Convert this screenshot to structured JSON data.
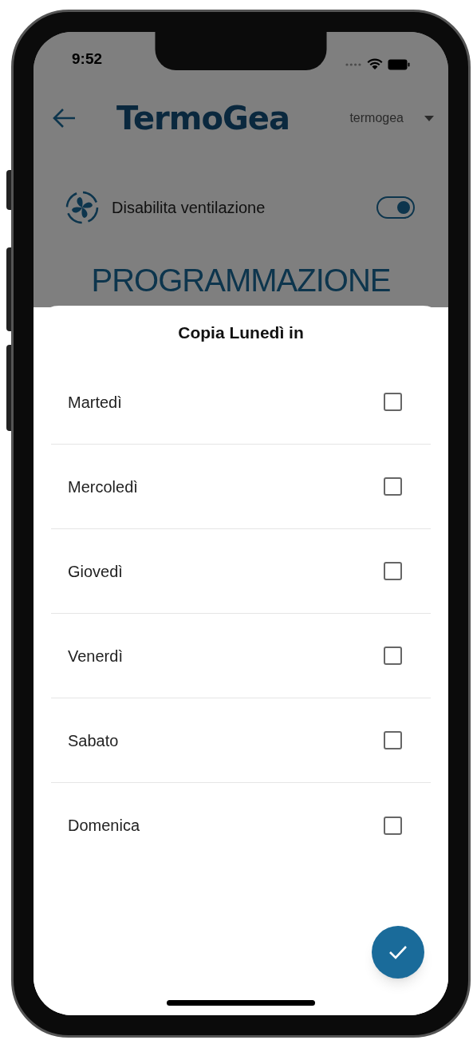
{
  "status_bar": {
    "time": "9:52"
  },
  "header": {
    "logo": "TermoGea",
    "account": "termogea"
  },
  "ventilation_toggle": {
    "label": "Disabilita ventilazione",
    "on": true
  },
  "page_title": "PROGRAMMAZIONE",
  "copy_sheet": {
    "title": "Copia Lunedì in",
    "days": [
      {
        "label": "Martedì",
        "checked": false
      },
      {
        "label": "Mercoledì",
        "checked": false
      },
      {
        "label": "Giovedì",
        "checked": false
      },
      {
        "label": "Venerdì",
        "checked": false
      },
      {
        "label": "Sabato",
        "checked": false
      },
      {
        "label": "Domenica",
        "checked": false
      }
    ]
  }
}
